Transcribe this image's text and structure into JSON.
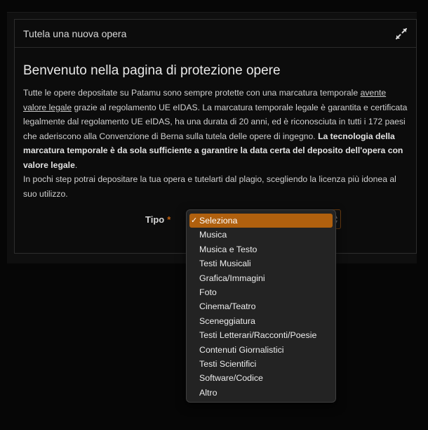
{
  "card": {
    "title": "Tutela una nuova opera"
  },
  "content": {
    "heading": "Benvenuto nella pagina di protezione opere",
    "intro_part1": "Tutte le opere depositate su Patamu sono sempre protette con una marcatura temporale ",
    "intro_link": "avente valore legale",
    "intro_part2": " grazie al regolamento UE eIDAS. La marcatura temporale legale è garantita e certificata legalmente dal regolamento UE eIDAS, ha una durata di 20 anni, ed è riconosciuta in tutti i 172 paesi che aderiscono alla Convenzione di Berna sulla tutela delle opere di ingegno. ",
    "intro_bold": "La tecnologia della marcatura temporale è da sola sufficiente a garantire la data certa del deposito dell'opera con valore legale",
    "intro_part3": ".",
    "intro_line2": "In pochi step potrai depositare la tua opera e tutelarti dal plagio, scegliendo la licenza più idonea al suo utilizzo."
  },
  "form": {
    "tipo_label": "Tipo",
    "required_mark": "*",
    "selected_value": "Seleziona"
  },
  "dropdown": {
    "check_mark": "✓",
    "options": [
      "Seleziona",
      "Musica",
      "Musica e Testo",
      "Testi Musicali",
      "Grafica/Immagini",
      "Foto",
      "Cinema/Teatro",
      "Sceneggiatura",
      "Testi Letterari/Racconti/Poesie",
      "Contenuti Giornalistici",
      "Testi Scientifici",
      "Software/Codice",
      "Altro"
    ]
  },
  "colors": {
    "accent": "#b0600e",
    "background": "#060606",
    "dropdown_bg": "#232323"
  },
  "icons": {
    "expand": "expand-icon"
  }
}
